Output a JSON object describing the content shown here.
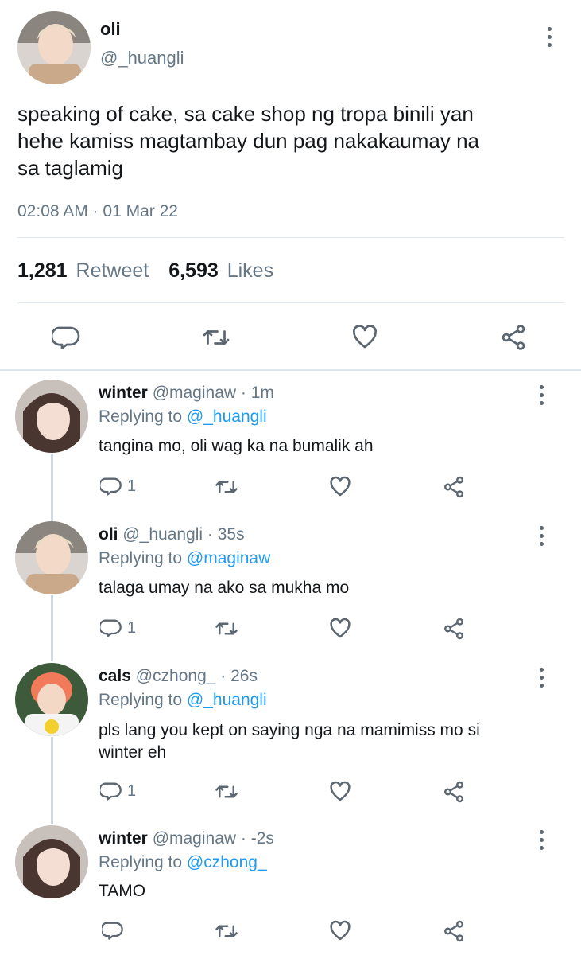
{
  "main_tweet": {
    "name": "oli",
    "handle": "@_huangli",
    "text_lines": [
      "speaking of cake, sa cake shop ng tropa binili yan",
      "hehe kamiss magtambay dun pag nakakaumay na",
      "sa taglamig"
    ],
    "timestamp": "02:08 AM · 01 Mar 22",
    "retweets_count": "1,281",
    "retweets_label": "Retweet",
    "likes_count": "6,593",
    "likes_label": "Likes"
  },
  "replies": [
    {
      "name": "winter",
      "meta": "@maginaw · 1m",
      "replying_prefix": "Replying to",
      "replying_handle": "@_huangli",
      "text": "tangina mo, oli wag ka na bumalik ah",
      "reply_count": "1"
    },
    {
      "name": "oli",
      "meta": "@_huangli · 35s",
      "replying_prefix": "Replying to",
      "replying_handle": "@maginaw",
      "text": "talaga umay na ako sa mukha mo",
      "reply_count": "1"
    },
    {
      "name": "cals",
      "meta": "@czhong_ · 26s",
      "replying_prefix": "Replying to",
      "replying_handle": "@_huangli",
      "text_lines": [
        "pls lang you kept on saying nga na mamimiss mo si",
        "winter eh"
      ],
      "reply_count": "1"
    },
    {
      "name": "winter",
      "meta": "@maginaw · -2s",
      "replying_prefix": "Replying to",
      "replying_handle": "@czhong_",
      "text": "TAMO",
      "reply_count": ""
    }
  ],
  "icons": [
    "comment-icon",
    "retweet-icon",
    "heart-icon",
    "share-icon",
    "more-options-icon"
  ],
  "colors": {
    "link": "#1d9bf0",
    "secondary_text": "#657786",
    "icon": "#5b6670"
  }
}
